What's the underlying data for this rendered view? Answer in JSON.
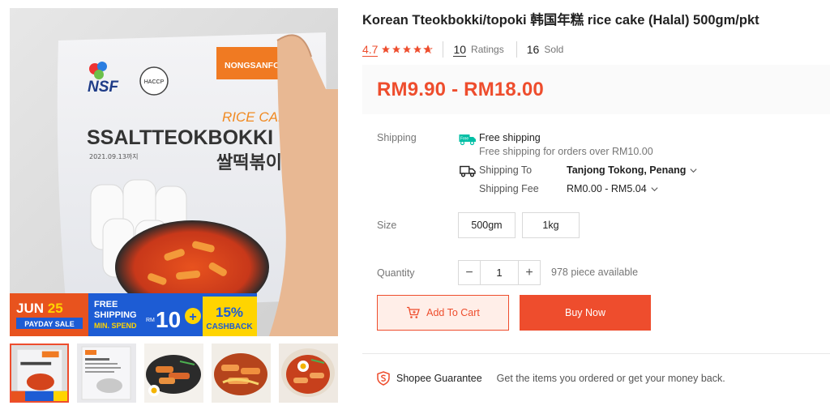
{
  "product": {
    "title": "Korean Tteokbokki/topoki 韩国年糕 rice cake (Halal) 500gm/pkt",
    "rating": "4.7",
    "stars_filled": 4.7,
    "ratings_count": "10",
    "ratings_label": "Ratings",
    "sold_count": "16",
    "sold_label": "Sold",
    "price": "RM9.90 - RM18.00"
  },
  "gallery": {
    "main_brand": "NSF",
    "main_maker": "NONGSANFOOD",
    "main_haccp": "HACCP",
    "main_product_en": "RICE CAKE",
    "main_product_name": "SSALTTEOKBOKKI",
    "main_product_kr": "쌀떡볶이",
    "main_date": "2021.09.13까지",
    "banner": {
      "month": "JUN",
      "day": "25",
      "sale_label": "PAYDAY SALE",
      "free": "FREE",
      "shipping": "SHIPPING",
      "min_spend": "MIN. SPEND",
      "rm": "RM",
      "amount": "10",
      "plus": "+",
      "percent": "15%",
      "cashback": "CASHBACK"
    },
    "thumbnail_count": 5,
    "active_thumbnail": 1
  },
  "shipping": {
    "label": "Shipping",
    "free_title": "Free shipping",
    "free_sub": "Free shipping for orders over RM10.00",
    "free_badge": "Free",
    "to_label": "Shipping To",
    "to_value": "Tanjong Tokong, Penang",
    "fee_label": "Shipping Fee",
    "fee_value": "RM0.00 - RM5.04"
  },
  "size": {
    "label": "Size",
    "options": [
      "500gm",
      "1kg"
    ]
  },
  "quantity": {
    "label": "Quantity",
    "minus": "−",
    "value": "1",
    "plus": "+",
    "available": "978 piece available"
  },
  "actions": {
    "add_to_cart": "Add To Cart",
    "buy_now": "Buy Now"
  },
  "guarantee": {
    "title": "Shopee Guarantee",
    "description": "Get the items you ordered or get your money back."
  },
  "colors": {
    "accent": "#ee4d2d",
    "star": "#ee4d2d",
    "free_ship": "#00bfa5",
    "banner_blue": "#1d5cd4",
    "banner_yellow": "#ffd400"
  }
}
